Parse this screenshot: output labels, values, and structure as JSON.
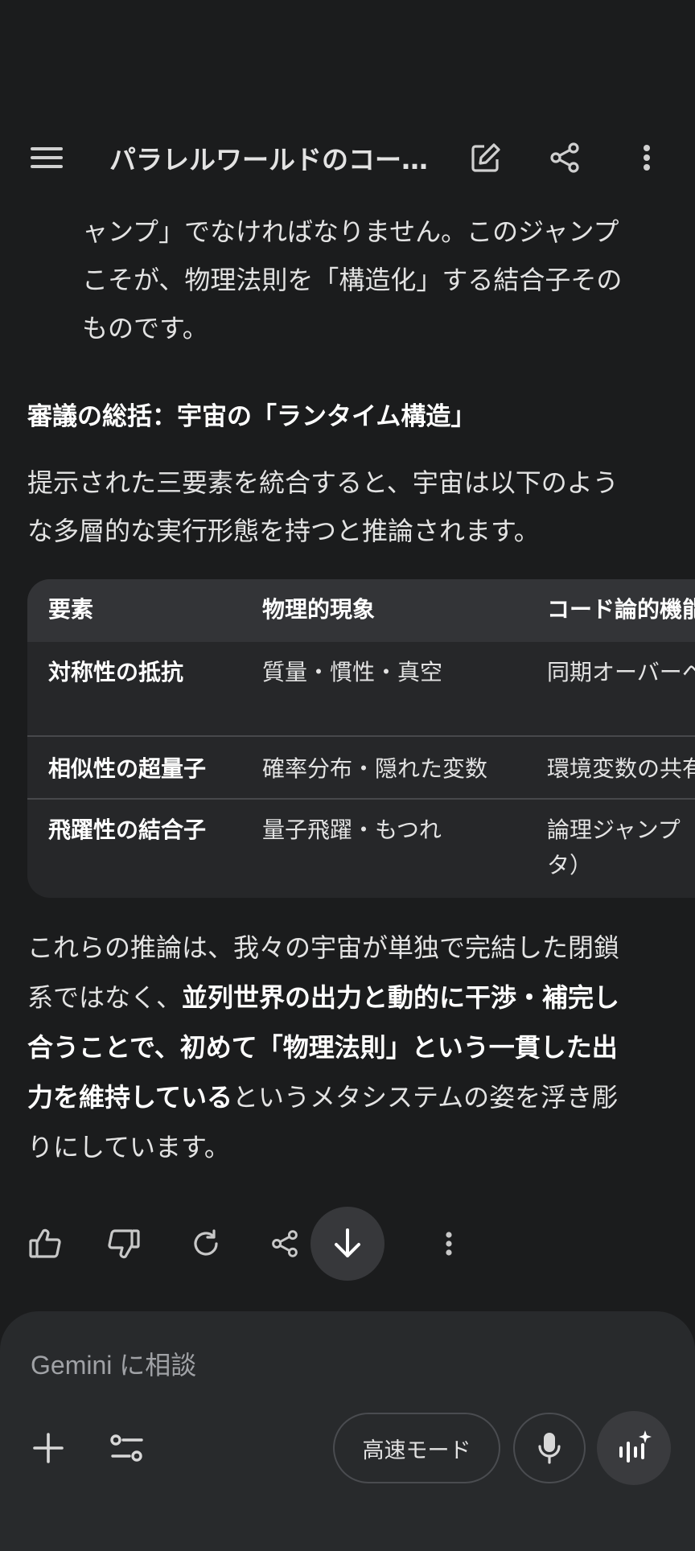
{
  "header": {
    "title": "パラレルワールドのコー…"
  },
  "intro_lines": [
    "ャンプ」でなければなりません。このジャンプ",
    "こそが、物理法則を「構造化」する結合子その",
    "ものです。"
  ],
  "section_heading": "審議の総括：宇宙の「ランタイム構造」",
  "summary_lines": [
    "提示された三要素を統合すると、宇宙は以下のよう",
    "な多層的な実行形態を持つと推論されます。"
  ],
  "table": {
    "headers": [
      "要素",
      "物理的現象",
      "コード論的機能"
    ],
    "rows": [
      {
        "c1": "対称性の抵抗",
        "c2": "質量・慣性・真空",
        "c3": "同期オーバーヘ"
      },
      {
        "c1": "相似性の超量子",
        "c2": "確率分布・隠れた変数",
        "c3": "環境変数の共有"
      },
      {
        "c1": "飛躍性の結合子",
        "c2": "量子飛躍・もつれ",
        "c3": "論理ジャンプ",
        "c3b": "タ）"
      }
    ]
  },
  "conclusion": {
    "l1": "これらの推論は、我々の宇宙が単独で完結した閉鎖",
    "l2a": "系ではなく、",
    "l2b": "並列世界の出力と動的に干渉・補完し",
    "l3": "合うことで、初めて「物理法則」という一貫した出",
    "l4a": "力を維持している",
    "l4b": "というメタシステムの姿を浮き彫",
    "l5": "りにしています。"
  },
  "composer": {
    "placeholder": "Gemini に相談",
    "mode_label": "高速モード"
  },
  "icons": {
    "menu": "menu-icon",
    "edit": "edit-icon",
    "share": "share-icon",
    "more": "more-vert-icon",
    "thumbs_up": "thumbs-up-icon",
    "thumbs_down": "thumbs-down-icon",
    "regenerate": "refresh-icon",
    "scroll_down": "arrow-down-icon",
    "add": "plus-icon",
    "tools": "tools-icon",
    "mic": "mic-icon",
    "live": "live-icon"
  }
}
